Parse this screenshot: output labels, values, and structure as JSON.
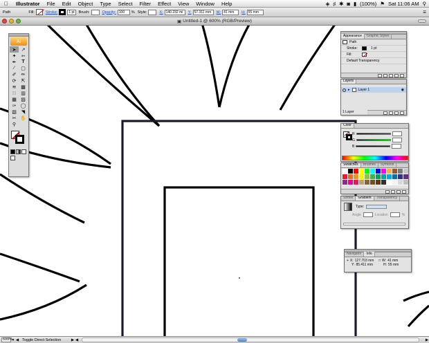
{
  "menubar": {
    "apple": "",
    "app_name": "Illustrator",
    "items": [
      "File",
      "Edit",
      "Object",
      "Type",
      "Select",
      "Filter",
      "Effect",
      "View",
      "Window",
      "Help"
    ],
    "battery": "(100%)",
    "clock": "Sat 11:06 AM"
  },
  "controlbar": {
    "selection_label": "Path",
    "fill_label": "Fill:",
    "stroke_label": "Stroke:",
    "stroke_weight": "1 pt",
    "brush_label": "Brush:",
    "opacity_label": "Opacity:",
    "opacity_value": "100",
    "opacity_unit": "%",
    "style_label": "Style:",
    "x_label": "X:",
    "x_value": "140.232 mi",
    "y_label": "Y:",
    "y_value": "57.311 mm",
    "w_label": "W:",
    "w_value": "41 mm",
    "h_label": "H:",
    "h_value": "55 mm"
  },
  "window": {
    "title": "Untitled-1 @ 600% (RGB/Preview)"
  },
  "statusbar": {
    "zoom": "600%",
    "status": "Toggle Direct Selection"
  },
  "panels": {
    "appearance": {
      "tabs": [
        "Appearance",
        "Graphic Styles"
      ],
      "rows": {
        "header": "Path",
        "stroke_label": "Stroke:",
        "stroke_value": "1 pt",
        "fill_label": "Fill:",
        "transparency": "Default Transparency"
      }
    },
    "layers": {
      "tabs": [
        "Layers"
      ],
      "layer_name": "Layer 1",
      "count": "1 Layer"
    },
    "color": {
      "tabs": [
        "Color"
      ],
      "channels": [
        "R",
        "G",
        "B"
      ]
    },
    "swatches": {
      "tabs": [
        "Swatches",
        "Brushes",
        "Symbols"
      ],
      "colors": [
        "#ffffff",
        "#000000",
        "#ff0000",
        "#ffff00",
        "#00ff00",
        "#00ffff",
        "#0000ff",
        "#ff00ff",
        "#fbb040",
        "#a0522d",
        "#7a7a7a",
        "#c8c8c8",
        "#ed1c24",
        "#f26522",
        "#f7941d",
        "#fff200",
        "#8dc63f",
        "#39b54a",
        "#00a651",
        "#00a99d",
        "#00aeef",
        "#0072bc",
        "#2e3192",
        "#662d91",
        "#92278f",
        "#ec008c",
        "#ed145b",
        "#c69c6d",
        "#8c6239",
        "#754c24",
        "#603913",
        "#362f2d",
        "#ffffff",
        "#f2f2f2",
        "#d9d9d9",
        "#bfbfbf"
      ]
    },
    "gradient": {
      "tabs": [
        "Stroke",
        "Gradient",
        "Transparency"
      ],
      "type_label": "Type:",
      "angle_label": "Angle",
      "location_label": "Location",
      "percent": "%"
    },
    "info": {
      "tabs": [
        "Navigator",
        "Info"
      ],
      "x_label": "X:",
      "x_value": "127.703 mm",
      "y_label": "Y:",
      "y_value": "85.411 mm",
      "w_label": "W:",
      "w_value": "41 mm",
      "h_label": "H:",
      "h_value": "55 mm"
    }
  },
  "tools": {
    "logo": "Ai",
    "icons": [
      "selection-arrow",
      "direct-selection",
      "magic-wand",
      "lasso",
      "pen",
      "type",
      "line",
      "rectangle",
      "paintbrush",
      "pencil",
      "rotate",
      "scale",
      "warp",
      "free-transform",
      "symbol-sprayer",
      "column-graph",
      "mesh",
      "gradient",
      "eyedropper",
      "blend",
      "live-paint",
      "slice",
      "scissors",
      "hand",
      "zoom"
    ]
  },
  "colors": {
    "accent": "#3f82d8",
    "layer_highlight": "#bcd3ef"
  }
}
